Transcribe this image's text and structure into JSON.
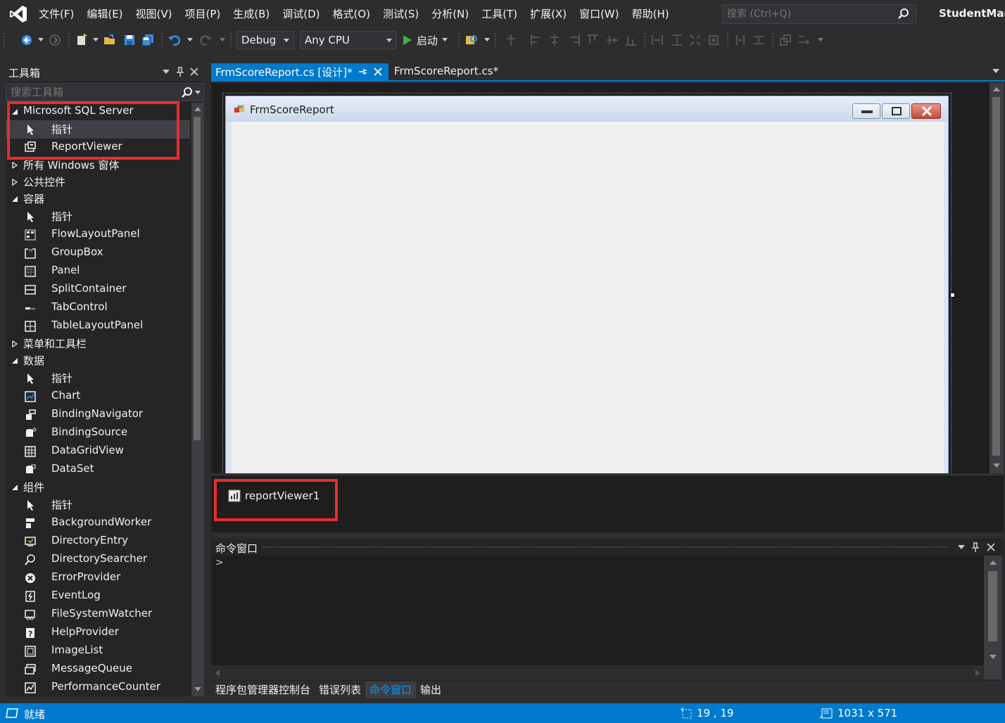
{
  "menu": {
    "items": [
      "文件(F)",
      "编辑(E)",
      "视图(V)",
      "项目(P)",
      "生成(B)",
      "调试(D)",
      "格式(O)",
      "测试(S)",
      "分析(N)",
      "工具(T)",
      "扩展(X)",
      "窗口(W)",
      "帮助(H)"
    ],
    "search_placeholder": "搜索 (Ctrl+Q)",
    "solution_name": "StudentMan"
  },
  "toolbar": {
    "configuration": "Debug",
    "platform": "Any CPU",
    "start_label": "启动"
  },
  "toolbox": {
    "title": "工具箱",
    "search_placeholder": "搜索工具箱",
    "rows": [
      {
        "type": "group",
        "expanded": true,
        "label": "Microsoft SQL Server"
      },
      {
        "type": "item",
        "icon": "pointer-icon",
        "label": "指针",
        "selected": true
      },
      {
        "type": "item",
        "icon": "reportviewer-icon",
        "label": "ReportViewer"
      },
      {
        "type": "group",
        "expanded": false,
        "label": "所有 Windows 窗体"
      },
      {
        "type": "group",
        "expanded": false,
        "label": "公共控件"
      },
      {
        "type": "group",
        "expanded": true,
        "label": "容器"
      },
      {
        "type": "item",
        "icon": "pointer-icon",
        "label": "指针"
      },
      {
        "type": "item",
        "icon": "flowlayoutpanel-icon",
        "label": "FlowLayoutPanel"
      },
      {
        "type": "item",
        "icon": "groupbox-icon",
        "label": "GroupBox"
      },
      {
        "type": "item",
        "icon": "panel-icon",
        "label": "Panel"
      },
      {
        "type": "item",
        "icon": "splitcontainer-icon",
        "label": "SplitContainer"
      },
      {
        "type": "item",
        "icon": "tabcontrol-icon",
        "label": "TabControl"
      },
      {
        "type": "item",
        "icon": "tablelayoutpanel-icon",
        "label": "TableLayoutPanel"
      },
      {
        "type": "group",
        "expanded": false,
        "label": "菜单和工具栏"
      },
      {
        "type": "group",
        "expanded": true,
        "label": "数据"
      },
      {
        "type": "item",
        "icon": "pointer-icon",
        "label": "指针"
      },
      {
        "type": "item",
        "icon": "chart-icon",
        "label": "Chart"
      },
      {
        "type": "item",
        "icon": "bindingnavigator-icon",
        "label": "BindingNavigator"
      },
      {
        "type": "item",
        "icon": "bindingsource-icon",
        "label": "BindingSource"
      },
      {
        "type": "item",
        "icon": "datagridview-icon",
        "label": "DataGridView"
      },
      {
        "type": "item",
        "icon": "dataset-icon",
        "label": "DataSet"
      },
      {
        "type": "group",
        "expanded": true,
        "label": "组件"
      },
      {
        "type": "item",
        "icon": "pointer-icon",
        "label": "指针"
      },
      {
        "type": "item",
        "icon": "backgroundworker-icon",
        "label": "BackgroundWorker"
      },
      {
        "type": "item",
        "icon": "directoryentry-icon",
        "label": "DirectoryEntry"
      },
      {
        "type": "item",
        "icon": "directorysearcher-icon",
        "label": "DirectorySearcher"
      },
      {
        "type": "item",
        "icon": "errorprovider-icon",
        "label": "ErrorProvider"
      },
      {
        "type": "item",
        "icon": "eventlog-icon",
        "label": "EventLog"
      },
      {
        "type": "item",
        "icon": "filesystemwatcher-icon",
        "label": "FileSystemWatcher"
      },
      {
        "type": "item",
        "icon": "helpprovider-icon",
        "label": "HelpProvider"
      },
      {
        "type": "item",
        "icon": "imagelist-icon",
        "label": "ImageList"
      },
      {
        "type": "item",
        "icon": "messagequeue-icon",
        "label": "MessageQueue"
      },
      {
        "type": "item",
        "icon": "performancecounter-icon",
        "label": "PerformanceCounter"
      }
    ]
  },
  "doc_tabs": {
    "designer": "FrmScoreReport.cs [设计]*",
    "code": "FrmScoreReport.cs*"
  },
  "designer": {
    "form_title": "FrmScoreReport"
  },
  "tray": {
    "component": "reportViewer1"
  },
  "command_window": {
    "title": "命令窗口",
    "prompt": ">"
  },
  "bottom_tabs": [
    "程序包管理器控制台",
    "错误列表",
    "命令窗口",
    "输出"
  ],
  "bottom_tabs_active": 2,
  "status": {
    "text": "就绪",
    "position": "19 , 19",
    "size": "1031 x 571"
  },
  "colors": {
    "accent": "#007acc",
    "highlight": "#e62e2e"
  }
}
